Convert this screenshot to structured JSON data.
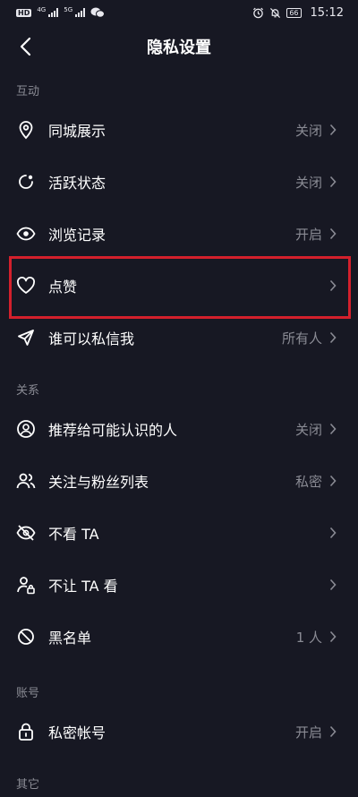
{
  "status": {
    "hd": "HD",
    "sig1": "4G",
    "sig2": "5G",
    "battery": "66",
    "time": "15:12"
  },
  "header": {
    "title": "隐私设置"
  },
  "sections": [
    {
      "title": "互动",
      "items": [
        {
          "label": "同城展示",
          "value": "关闭"
        },
        {
          "label": "活跃状态",
          "value": "关闭"
        },
        {
          "label": "浏览记录",
          "value": "开启"
        },
        {
          "label": "点赞",
          "value": ""
        },
        {
          "label": "谁可以私信我",
          "value": "所有人"
        }
      ]
    },
    {
      "title": "关系",
      "items": [
        {
          "label": "推荐给可能认识的人",
          "value": "关闭"
        },
        {
          "label": "关注与粉丝列表",
          "value": "私密"
        },
        {
          "label": "不看 TA",
          "value": ""
        },
        {
          "label": "不让 TA 看",
          "value": ""
        },
        {
          "label": "黑名单",
          "value": "1 人"
        }
      ]
    },
    {
      "title": "账号",
      "items": [
        {
          "label": "私密帐号",
          "value": "开启"
        }
      ]
    },
    {
      "title": "其它"
    }
  ],
  "colors": {
    "background": "#171823",
    "highlight": "#d3202c",
    "muted": "#8a8b94"
  }
}
